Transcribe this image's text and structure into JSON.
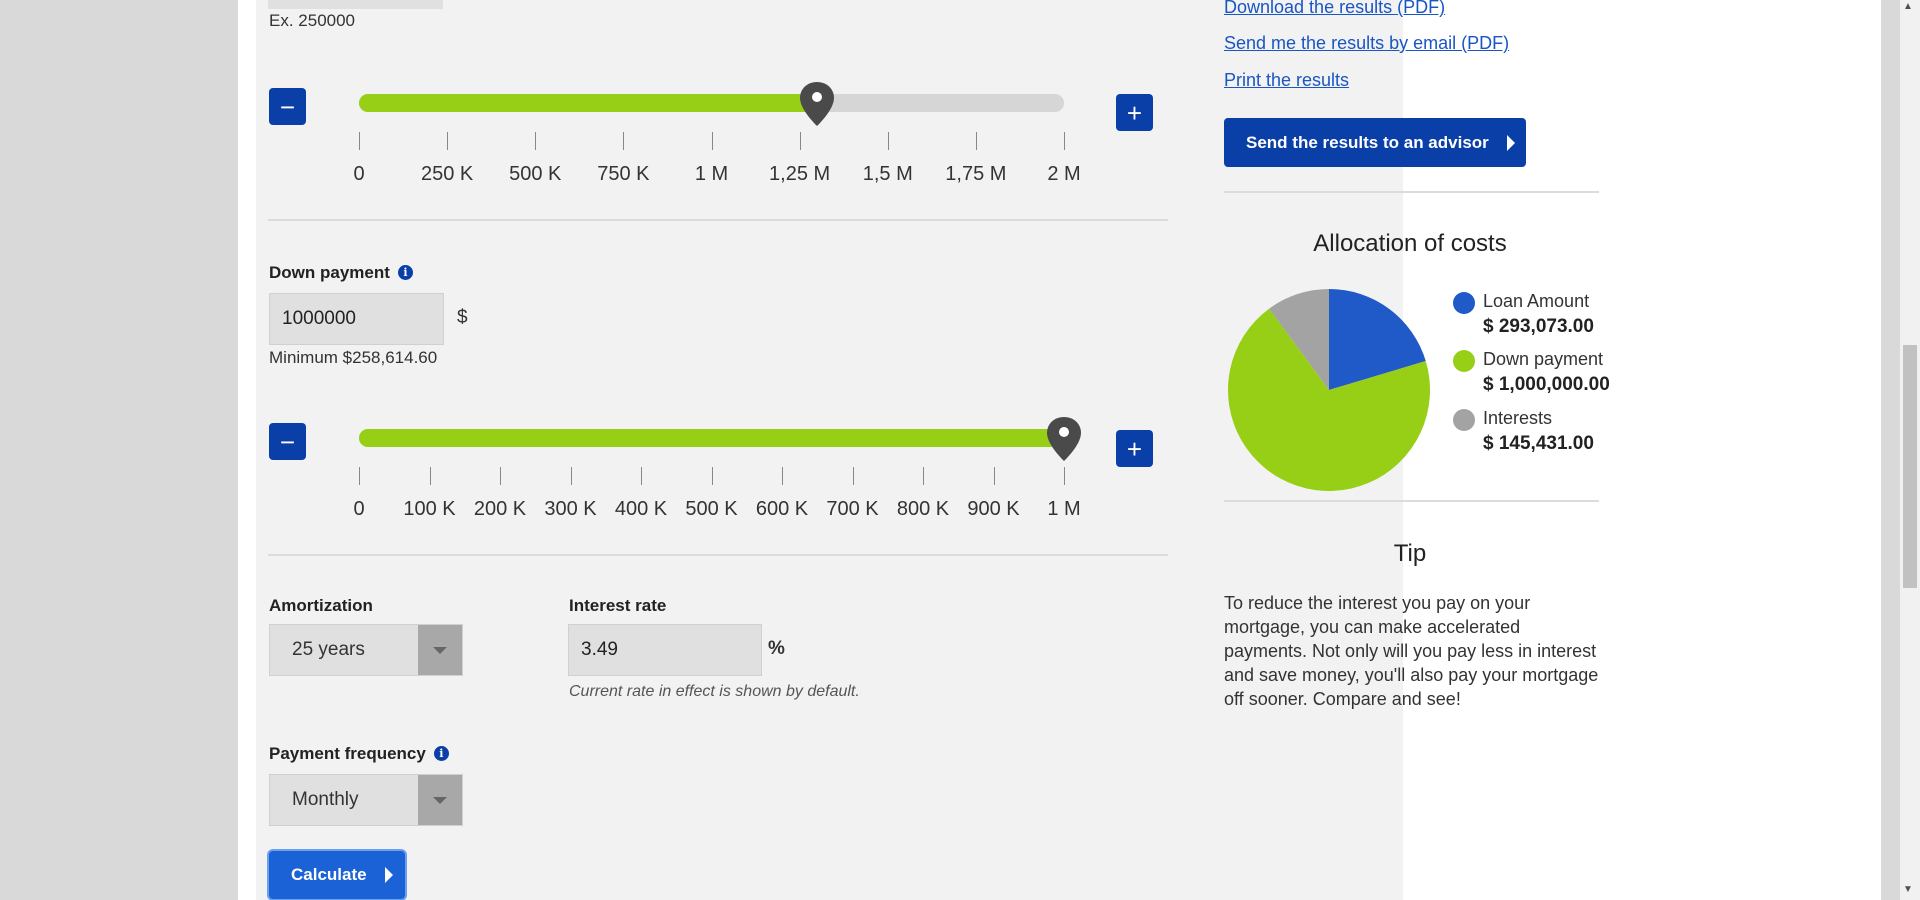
{
  "loan_amount_section": {
    "example_text": "Ex. 250000",
    "slider_value": 1300000,
    "slider_max": 2000000,
    "tick_labels": [
      "0",
      "250 K",
      "500 K",
      "750 K",
      "1 M",
      "1,25 M",
      "1,5 M",
      "1,75 M",
      "2 M"
    ],
    "minus_label": "−",
    "plus_label": "+"
  },
  "down_payment": {
    "label": "Down payment",
    "info_icon": "i",
    "value": "1000000",
    "currency": "$",
    "minimum_text": "Minimum $258,614.60",
    "slider_value": 1000000,
    "slider_max": 1000000,
    "tick_labels": [
      "0",
      "100 K",
      "200 K",
      "300 K",
      "400 K",
      "500 K",
      "600 K",
      "700 K",
      "800 K",
      "900 K",
      "1 M"
    ],
    "minus_label": "−",
    "plus_label": "+"
  },
  "amortization": {
    "label": "Amortization",
    "selected": "25 years"
  },
  "interest_rate": {
    "label": "Interest rate",
    "value": "3.49",
    "unit": "%",
    "note": "Current rate in effect is shown by default."
  },
  "payment_frequency": {
    "label": "Payment frequency",
    "info_icon": "i",
    "selected": "Monthly"
  },
  "calculate_button": "Calculate",
  "results_links": {
    "download_pdf": "Download the results (PDF)",
    "email_pdf": "Send me the results by email (PDF)",
    "print": "Print the results"
  },
  "advisor_button": "Send the results to an advisor",
  "allocation": {
    "title": "Allocation of costs",
    "items": [
      {
        "name": "Loan Amount",
        "value": "$ 293,073.00",
        "amount": 293073,
        "color": "#1f5ac8"
      },
      {
        "name": "Down payment",
        "value": "$ 1,000,000.00",
        "amount": 1000000,
        "color": "#97cf16"
      },
      {
        "name": "Interests",
        "value": "$ 145,431.00",
        "amount": 145431,
        "color": "#a3a3a3"
      }
    ]
  },
  "chart_data": {
    "type": "pie",
    "title": "Allocation of costs",
    "categories": [
      "Loan Amount",
      "Down payment",
      "Interests"
    ],
    "values": [
      293073,
      1000000,
      145431
    ],
    "colors": [
      "#1f5ac8",
      "#97cf16",
      "#a3a3a3"
    ],
    "legend_position": "right"
  },
  "tip": {
    "title": "Tip",
    "text": "To reduce the interest you pay on your mortgage, you can make accelerated payments. Not only will you pay less in interest and save money, you'll also pay your mortgage off sooner. Compare and see!"
  },
  "colors": {
    "brand_blue": "#0b3fa8",
    "slider_green": "#97cf16",
    "link_blue": "#1a55c4"
  }
}
